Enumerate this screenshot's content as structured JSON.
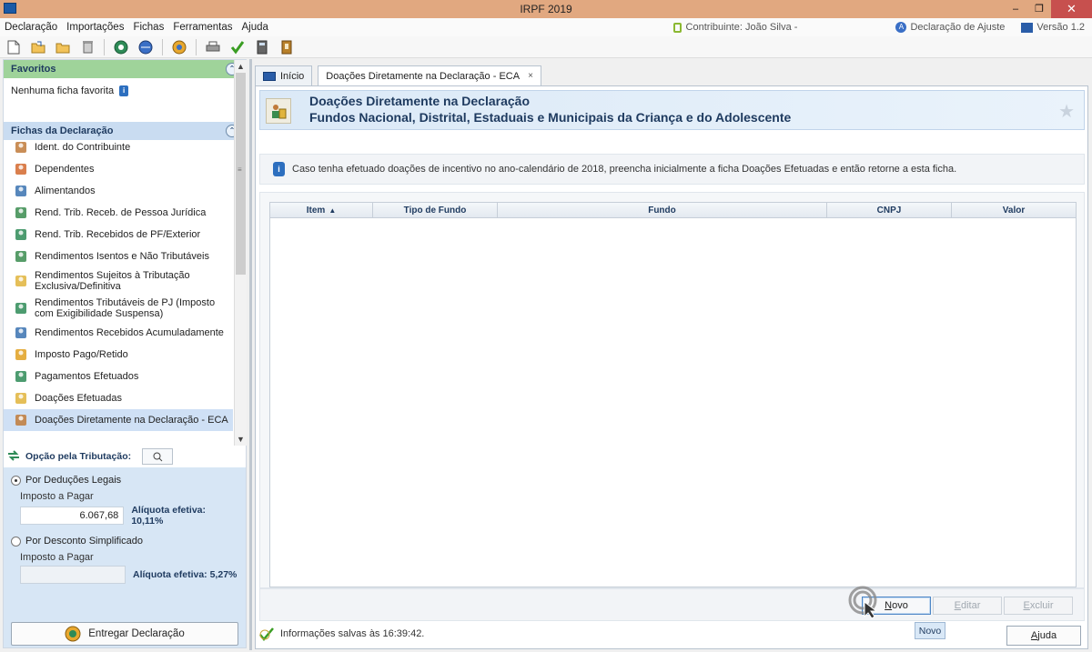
{
  "window": {
    "title": "IRPF 2019"
  },
  "menu": {
    "items": [
      "Declaração",
      "Importações",
      "Fichas",
      "Ferramentas",
      "Ajuda"
    ],
    "contribuinte": "Contribuinte: João Silva -",
    "declaracao": "Declaração de Ajuste",
    "versao": "Versão 1.2"
  },
  "toolbar": {
    "icons": [
      "new-file-icon",
      "open-folder-icon",
      "folder-icon",
      "trash-icon",
      "globe-arrow-icon",
      "globe-receive-icon",
      "globe-search-icon",
      "printer-icon",
      "check-icon",
      "calculator-icon",
      "book-icon"
    ]
  },
  "sidebar": {
    "favoritos_title": "Favoritos",
    "favoritos_empty": "Nenhuma ficha favorita",
    "fichas_title": "Fichas da Declaração",
    "fichas": [
      {
        "label": "Ident. do Contribuinte",
        "icon": "person-icon"
      },
      {
        "label": "Dependentes",
        "icon": "dependents-icon"
      },
      {
        "label": "Alimentandos",
        "icon": "people-icon"
      },
      {
        "label": "Rend. Trib. Receb. de Pessoa Jurídica",
        "icon": "income-pj-icon"
      },
      {
        "label": "Rend. Trib. Recebidos de PF/Exterior",
        "icon": "income-pf-icon"
      },
      {
        "label": "Rendimentos Isentos e Não Tributáveis",
        "icon": "exempt-income-icon"
      },
      {
        "label": "Rendimentos Sujeitos à Tributação Exclusiva/Definitiva",
        "icon": "exclusive-tax-icon"
      },
      {
        "label": "Rendimentos Tributáveis de PJ (Imposto com Exigibilidade Suspensa)",
        "icon": "suspended-tax-icon"
      },
      {
        "label": "Rendimentos Recebidos Acumuladamente",
        "icon": "accumulated-income-icon"
      },
      {
        "label": "Imposto Pago/Retido",
        "icon": "tax-paid-icon"
      },
      {
        "label": "Pagamentos Efetuados",
        "icon": "payments-icon"
      },
      {
        "label": "Doações Efetuadas",
        "icon": "donations-icon"
      },
      {
        "label": "Doações Diretamente na Declaração - ECA",
        "icon": "eca-donation-icon"
      }
    ],
    "active_index": 12
  },
  "tributacao": {
    "title": "Opção pela Tributação:",
    "deducoes_label": "Por Deduções Legais",
    "deducoes_imposto_label": "Imposto a Pagar",
    "deducoes_imposto_value": "6.067,68",
    "deducoes_aliquota": "Alíquota efetiva: 10,11%",
    "simplificado_label": "Por Desconto Simplificado",
    "simplificado_imposto_label": "Imposto a Pagar",
    "simplificado_imposto_value": "",
    "simplificado_aliquota": "Alíquota efetiva: 5,27%",
    "selected": "deducoes",
    "entregar_label": "Entregar Declaração"
  },
  "tabs": [
    {
      "label": "Início"
    },
    {
      "label": "Doações Diretamente na Declaração - ECA",
      "closable": "×"
    }
  ],
  "main": {
    "title1": "Doações Diretamente na Declaração",
    "title2": "Fundos Nacional, Distrital, Estaduais e Municipais da Criança e do Adolescente",
    "info": "Caso tenha efetuado doações de incentivo no ano-calendário de 2018, preencha inicialmente a ficha Doações Efetuadas e então retorne a esta ficha.",
    "columns": [
      "Item",
      "Tipo de Fundo",
      "Fundo",
      "CNPJ",
      "Valor"
    ],
    "sort_arrow": "▲",
    "rows": [],
    "buttons": {
      "novo": "Novo",
      "editar": "Editar",
      "excluir": "Excluir"
    }
  },
  "status": {
    "saved": "Informações salvas às 16:39:42.",
    "tooltip": "Novo",
    "ajuda": "Ajuda"
  },
  "colors": {
    "titlebar": "#e1a880",
    "favoritos": "#9fd39a",
    "fichas": "#c9dcf1",
    "accent": "#1e3a5f"
  }
}
